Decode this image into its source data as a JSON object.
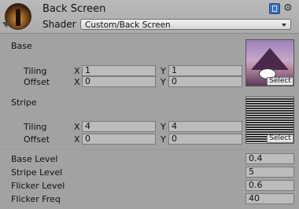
{
  "header": {
    "title": "Back Screen",
    "shader_label": "Shader",
    "shader_value": "Custom/Back Screen"
  },
  "base": {
    "label": "Base",
    "tiling_label": "Tiling",
    "offset_label": "Offset",
    "x_label": "X",
    "y_label": "Y",
    "tiling_x": "1",
    "tiling_y": "1",
    "offset_x": "0",
    "offset_y": "0",
    "select_label": "Select"
  },
  "stripe": {
    "label": "Stripe",
    "tiling_label": "Tiling",
    "offset_label": "Offset",
    "x_label": "X",
    "y_label": "Y",
    "tiling_x": "4",
    "tiling_y": "4",
    "offset_x": "0",
    "offset_y": "0",
    "select_label": "Select"
  },
  "properties": [
    {
      "label": "Base Level",
      "value": "0.4"
    },
    {
      "label": "Stripe Level",
      "value": "5"
    },
    {
      "label": "Flicker Level",
      "value": "0.6"
    },
    {
      "label": "Flicker Freq",
      "value": "40"
    }
  ],
  "icons": [
    "shader-thumbnail-icon",
    "help-book-icon",
    "gear-icon",
    "collapse-arrow-icon"
  ]
}
